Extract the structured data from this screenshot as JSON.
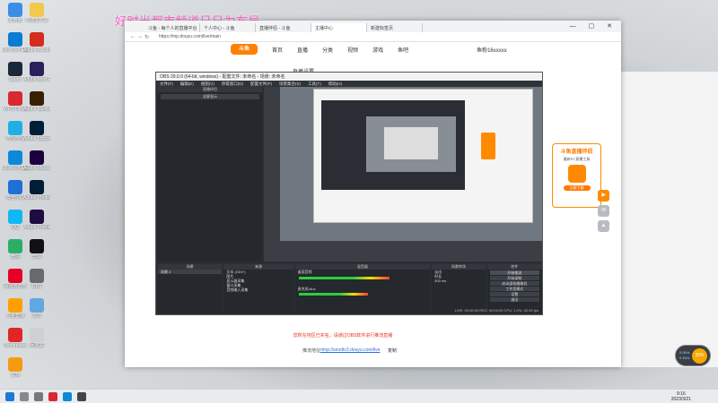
{
  "overlay": {
    "title": "好时光都市频道日日为布局"
  },
  "desktop": {
    "icons": [
      {
        "label": "此电脑",
        "color": "#3b8ee8"
      },
      {
        "label": "新建文件夹",
        "color": "#f2c94c"
      },
      {
        "label": "Microsoft Edge",
        "color": "#0a7cd1"
      },
      {
        "label": "Adobe Acrobat",
        "color": "#d62b1f"
      },
      {
        "label": "Steam",
        "color": "#1b2838"
      },
      {
        "label": "Adobe After Effects",
        "color": "#2b1f5c"
      },
      {
        "label": "WPS Office",
        "color": "#d9282f"
      },
      {
        "label": "Adobe Illustrator",
        "color": "#3a2000"
      },
      {
        "label": "哔哩哔哩",
        "color": "#23ade5"
      },
      {
        "label": "Adobe Lightroom",
        "color": "#001e36"
      },
      {
        "label": "Microsoft Edge",
        "color": "#0c8ad8"
      },
      {
        "label": "Adobe Media Encoder",
        "color": "#1c003d"
      },
      {
        "label": "安全中心",
        "color": "#1f6fd8"
      },
      {
        "label": "Adobe Photoshop",
        "color": "#001e36"
      },
      {
        "label": "QQ",
        "color": "#12b7f5"
      },
      {
        "label": "Adobe Premiere",
        "color": "#1e0b3f"
      },
      {
        "label": "微信",
        "color": "#2aae67"
      },
      {
        "label": "剪映",
        "color": "#111111"
      },
      {
        "label": "网易云音乐",
        "color": "#e60026"
      },
      {
        "label": "OBS",
        "color": "#6a6a6a"
      },
      {
        "label": "斗鱼直播",
        "color": "#ffa000"
      },
      {
        "label": "文件",
        "color": "#5fa8e0"
      },
      {
        "label": "Streamlabs",
        "color": "#e02626"
      },
      {
        "label": "回收站",
        "color": "#d0d0d0"
      },
      {
        "label": "文档",
        "color": "#f39c12"
      }
    ]
  },
  "browser": {
    "tabs": [
      "斗鱼 - 每个人的直播平台",
      "个人中心 - 斗鱼",
      "直播伴侣 - 斗鱼",
      "主播中心",
      "新建标签页"
    ],
    "url": "https://mp.douyu.com/live/main",
    "nav": {
      "logo": "斗鱼",
      "items": [
        "首页",
        "直播",
        "分类",
        "视频",
        "游戏",
        "鱼吧"
      ],
      "user": "鱼粉16xxxxx"
    },
    "page": {
      "heading": "直播设置",
      "notice_line1": "您所在地区已实名，请通过OBS软件进行推流直播",
      "link_label": "推流地址",
      "link_text": "rtmp://sendtc3.douyu.com/live",
      "copy_label": "复制"
    }
  },
  "obs": {
    "title": "OBS 29.0.0 (64-bit, windows) - 配置文件: 未命名 - 场景: 未命名",
    "menu": [
      "文件(F)",
      "编辑(E)",
      "视图(V)",
      "停靠窗口(D)",
      "配置文件(P)",
      "场景集合(S)",
      "工具(T)",
      "帮助(H)"
    ],
    "left_panel": {
      "header": "直播伴侣",
      "button": "全屏显示"
    },
    "docks": {
      "scenes": {
        "header": "场景",
        "items": [
          "场景 2"
        ]
      },
      "sources": {
        "header": "来源",
        "items": [
          "文本 (GDI+)",
          "图片",
          "显示器采集",
          "窗口采集",
          "音频输入采集"
        ]
      },
      "mixer": {
        "header": "混音器",
        "items": [
          "桌面音频",
          "麦克风/Aux"
        ],
        "levels": [
          0.72,
          0.55
        ]
      },
      "transitions": {
        "header": "场景转场",
        "fade": "淡出",
        "duration_label": "时长",
        "duration": "300 ms"
      },
      "controls": {
        "header": "控件",
        "buttons": [
          "开始推流",
          "开始录制",
          "启动虚拟摄像机",
          "工作室模式",
          "设置",
          "退出"
        ]
      }
    },
    "status": "LIVE: 00:00:00  REC: 00:00:00  CPU: 1.0%, 30.00 fps"
  },
  "promo": {
    "title": "斗鱼直播伴侣",
    "subtitle": "最新PC直播工具",
    "button": "立即下载"
  },
  "taskbar": {
    "time": "9:16",
    "date": "2023/3/21"
  },
  "widget": {
    "percent": "35%",
    "up": "0.0K/s",
    "down": "0.1K/s"
  }
}
